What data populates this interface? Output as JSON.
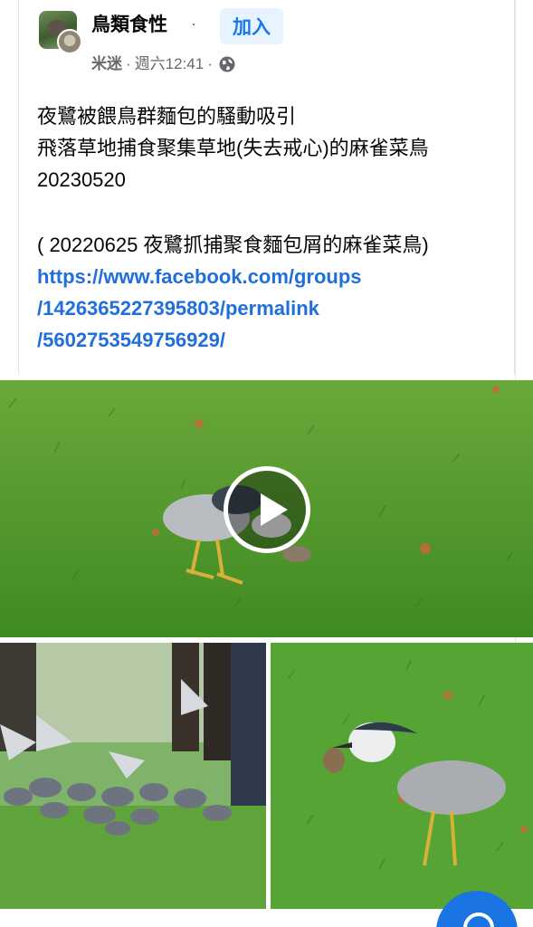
{
  "header": {
    "group_name": "鳥類食性",
    "dot": "·",
    "join_label": "加入",
    "author": "米迷",
    "timestamp": "週六12:41",
    "privacy_icon": "globe-icon"
  },
  "post": {
    "lines": [
      "夜鷺被餵鳥群麵包的騷動吸引",
      "飛落草地捕食聚集草地(失去戒心)的麻雀菜鳥",
      "20230520",
      "( 20220625 夜鷺抓捕聚食麵包屑的麻雀菜鳥)"
    ],
    "link_lines": [
      "https://www.facebook.com/groups",
      "/1426365227395803/permalink",
      "/5602753549756929/"
    ]
  },
  "media": {
    "top": "night-heron-catching-sparrow-video",
    "bottom_left": "pigeon-flock-on-lawn-photo",
    "bottom_right": "night-heron-with-sparrow-photo",
    "play_icon": "play-icon"
  },
  "colors": {
    "accent": "#1877f2",
    "join_bg": "#e7f3ff",
    "link": "#216fdb",
    "meta": "#65676b",
    "grass": "#4f9a2c"
  }
}
